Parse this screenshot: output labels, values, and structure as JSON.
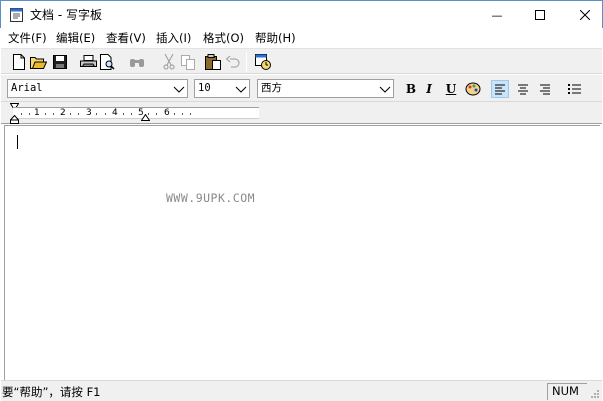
{
  "window": {
    "title": "文档 - 写字板",
    "minimize_glyph": "—",
    "maximize_glyph": "☐",
    "close_glyph": "✕"
  },
  "menu": {
    "items": [
      {
        "label": "文件(F)"
      },
      {
        "label": "编辑(E)"
      },
      {
        "label": "查看(V)"
      },
      {
        "label": "插入(I)"
      },
      {
        "label": "格式(O)"
      },
      {
        "label": "帮助(H)"
      }
    ]
  },
  "toolbar": {
    "icons": [
      "new-document-icon",
      "open-folder-icon",
      "save-icon",
      "print-icon",
      "print-preview-icon",
      "find-icon",
      "cut-icon",
      "copy-icon",
      "paste-icon",
      "undo-icon",
      "insert-datetime-icon"
    ]
  },
  "format_bar": {
    "font_name": "Arial",
    "font_size": "10",
    "script": "西方",
    "bold_label": "B",
    "italic_label": "I",
    "underline_label": "U",
    "icons": [
      "color-icon",
      "align-left-icon",
      "align-center-icon",
      "align-right-icon",
      "bullets-icon"
    ]
  },
  "ruler": {
    "labels": [
      "1",
      "2",
      "3",
      "4",
      "5",
      "6"
    ]
  },
  "document": {
    "watermark": "WWW.9UPK.COM"
  },
  "status": {
    "help_text": "要“帮助”，请按 F1",
    "num_indicator": "NUM"
  },
  "colors": {
    "window_border": "#5b8fc7",
    "toolbar_bg": "#f0f0f0",
    "active_button": "#cce4f7"
  }
}
